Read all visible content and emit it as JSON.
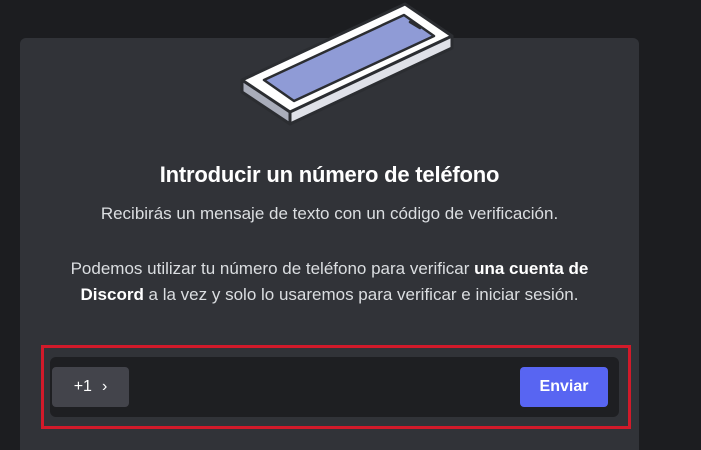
{
  "modal": {
    "title": "Introducir un número de teléfono",
    "subtitle": "Recibirás un mensaje de texto con un código de verificación.",
    "body_part1": "Podemos utilizar tu número de teléfono para verificar ",
    "body_bold": "una cuenta de Discord",
    "body_part2": " a la vez y solo lo usaremos para verificar e iniciar sesión.",
    "illustration_icon": "smartphone-icon"
  },
  "phone_form": {
    "country_code": "+1",
    "chevron_glyph": "›",
    "chevron_icon": "chevron-right-icon",
    "phone_value": "",
    "send_label": "Enviar"
  },
  "colors": {
    "modal_bg": "#313338",
    "accent": "#5865f2",
    "highlight_border": "#d11a2a"
  }
}
